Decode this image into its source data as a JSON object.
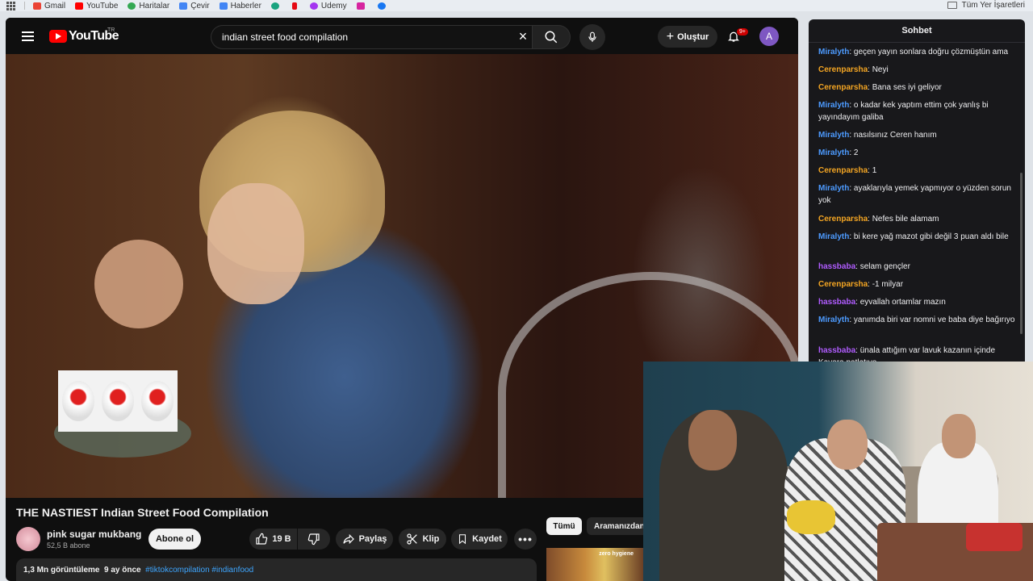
{
  "bookmarks": {
    "items": [
      {
        "label": "Gmail",
        "color": "#ea4335"
      },
      {
        "label": "YouTube",
        "color": "#ff0000"
      },
      {
        "label": "Haritalar",
        "color": "#34a853"
      },
      {
        "label": "Çevir",
        "color": "#4285f4"
      },
      {
        "label": "Haberler",
        "color": "#4285f4"
      }
    ],
    "udemy": "Udemy",
    "all_bookmarks": "Tüm Yer İşaretleri"
  },
  "masthead": {
    "logo": "YouTube",
    "country": "TR",
    "search_value": "indian street food compilation",
    "create_label": "Oluştur",
    "notif_badge": "9+",
    "avatar_letter": "A"
  },
  "video": {
    "title": "THE NASTIEST Indian Street Food Compilation",
    "channel": "pink sugar mukbang",
    "subscribers": "52,5 B abone",
    "subscribe_label": "Abone ol",
    "likes": "19 B",
    "share_label": "Paylaş",
    "clip_label": "Klip",
    "save_label": "Kaydet",
    "views": "1,3 Mn görüntüleme",
    "age": "9 ay önce",
    "tags": "#tiktokcompilation #indianfood"
  },
  "related": {
    "chip_all": "Tümü",
    "chip_related": "Aramanızdan",
    "thumb_text": "zero hygiene"
  },
  "chat": {
    "header": "Sohbet",
    "messages": [
      {
        "user": "Miralyth",
        "color": "#4d9bff",
        "text": ": geçen yayın sonlara doğru çözmüştün ama"
      },
      {
        "user": "Cerenparsha",
        "color": "#f5a623",
        "text": ": Neyi"
      },
      {
        "user": "Cerenparsha",
        "color": "#f5a623",
        "text": ": Bana ses iyi geliyor"
      },
      {
        "user": "Miralyth",
        "color": "#4d9bff",
        "text": ": o kadar kek yaptım ettim çok yanlış bi yayındayım galiba"
      },
      {
        "user": "Miralyth",
        "color": "#4d9bff",
        "text": ": nasılsınız Ceren hanım"
      },
      {
        "user": "Miralyth",
        "color": "#4d9bff",
        "text": ": 2"
      },
      {
        "user": "Cerenparsha",
        "color": "#f5a623",
        "text": ": 1"
      },
      {
        "user": "Miralyth",
        "color": "#4d9bff",
        "text": ": ayaklarıyla yemek yapmıyor o yüzden sorun yok"
      },
      {
        "user": "Cerenparsha",
        "color": "#f5a623",
        "text": ": Nefes bile alamam"
      },
      {
        "user": "Miralyth",
        "color": "#4d9bff",
        "text": ": bi kere yağ mazot gibi değil 3 puan aldı bile"
      },
      {
        "user": "hassbaba",
        "color": "#b05cff",
        "text": ": selam gençler"
      },
      {
        "user": "Cerenparsha",
        "color": "#f5a623",
        "text": ": -1 milyar"
      },
      {
        "user": "hassbaba",
        "color": "#b05cff",
        "text": ": eyvallah ortamlar mazın"
      },
      {
        "user": "Miralyth",
        "color": "#4d9bff",
        "text": ": yanımda biri var nomni ve baba diye bağırıyo"
      },
      {
        "user": "hassbaba",
        "color": "#b05cff",
        "text": ": ünala attığım var lavuk kazanın içinde Kayara patlatıyo"
      }
    ]
  }
}
